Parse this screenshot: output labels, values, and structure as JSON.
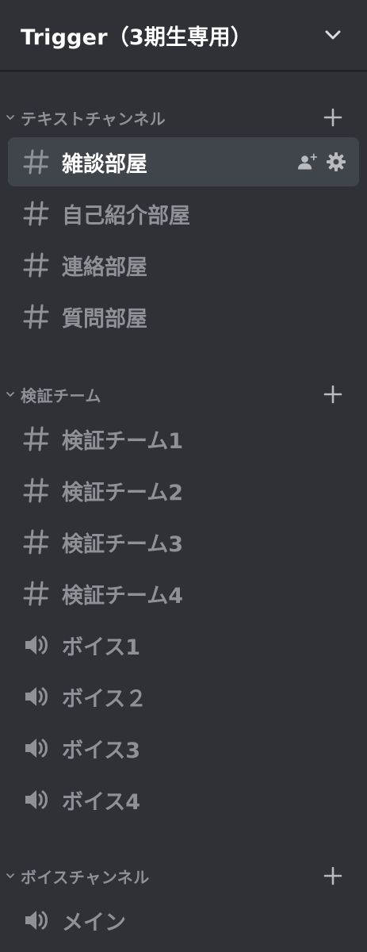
{
  "server": {
    "name": "Trigger（3期生専用）"
  },
  "categories": [
    {
      "label": "テキストチャンネル",
      "channels": [
        {
          "type": "text",
          "label": "雑談部屋",
          "active": true
        },
        {
          "type": "text",
          "label": "自己紹介部屋"
        },
        {
          "type": "text",
          "label": "連絡部屋"
        },
        {
          "type": "text",
          "label": "質問部屋"
        }
      ]
    },
    {
      "label": "検証チーム",
      "channels": [
        {
          "type": "text",
          "label": "検証チーム1"
        },
        {
          "type": "text",
          "label": "検証チーム2"
        },
        {
          "type": "text",
          "label": "検証チーム3"
        },
        {
          "type": "text",
          "label": "検証チーム4"
        },
        {
          "type": "voice",
          "label": "ボイス1"
        },
        {
          "type": "voice",
          "label": "ボイス２"
        },
        {
          "type": "voice",
          "label": "ボイス3"
        },
        {
          "type": "voice",
          "label": "ボイス4"
        }
      ]
    },
    {
      "label": "ボイスチャンネル",
      "channels": [
        {
          "type": "voice",
          "label": "メイン"
        }
      ]
    }
  ],
  "icons": {
    "chevron": "chevron-down-icon",
    "plus": "plus-icon",
    "text_channel": "hash-icon",
    "voice_channel": "speaker-icon",
    "invite": "add-member-icon",
    "settings": "gear-icon"
  },
  "colors": {
    "background": "#2f3136",
    "active_background": "#40444b",
    "muted_text": "#8e9297",
    "active_text": "#ffffff",
    "divider": "#202225"
  }
}
